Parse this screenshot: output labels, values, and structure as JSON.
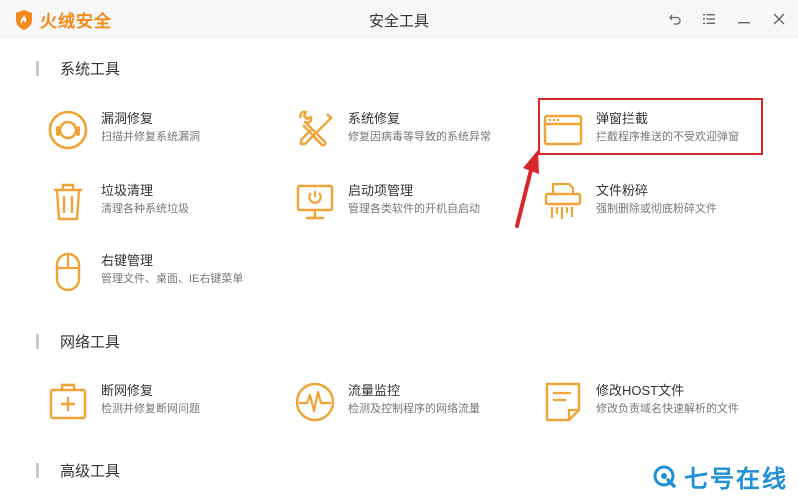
{
  "app": {
    "brand_name": "火绒安全",
    "window_title": "安全工具",
    "accent_color": "#f28b1b"
  },
  "window_controls": {
    "back_icon": "back-arrow-icon",
    "menu_icon": "menu-icon",
    "minimize_icon": "minimize-icon",
    "close_icon": "close-icon"
  },
  "sections": {
    "system": {
      "title": "系统工具",
      "tools": [
        {
          "name": "漏洞修复",
          "desc": "扫描并修复系统漏洞",
          "icon": "lifebuoy-icon"
        },
        {
          "name": "系统修复",
          "desc": "修复因病毒等导致的系统异常",
          "icon": "wrench-screwdriver-icon"
        },
        {
          "name": "弹窗拦截",
          "desc": "拦截程序推送的不受欢迎弹窗",
          "icon": "popup-window-icon"
        },
        {
          "name": "垃圾清理",
          "desc": "清理各种系统垃圾",
          "icon": "trash-bin-icon"
        },
        {
          "name": "启动项管理",
          "desc": "管理各类软件的开机自启动",
          "icon": "monitor-startup-icon"
        },
        {
          "name": "文件粉碎",
          "desc": "强制删除或彻底粉碎文件",
          "icon": "shredder-icon"
        },
        {
          "name": "右键管理",
          "desc": "管理文件、桌面、IE右键菜单",
          "icon": "mouse-icon"
        }
      ]
    },
    "network": {
      "title": "网络工具",
      "tools": [
        {
          "name": "断网修复",
          "desc": "检测并修复断网问题",
          "icon": "first-aid-kit-icon"
        },
        {
          "name": "流量监控",
          "desc": "检测及控制程序的网络流量",
          "icon": "traffic-pulse-icon"
        },
        {
          "name": "修改HOST文件",
          "desc": "修改负责域名快速解析的文件",
          "icon": "host-file-icon"
        }
      ]
    },
    "advanced": {
      "title": "高级工具"
    }
  },
  "watermark": {
    "text": "七号在线",
    "color": "#1f8fd8"
  },
  "annotation": {
    "highlight_color": "#d9262b"
  }
}
